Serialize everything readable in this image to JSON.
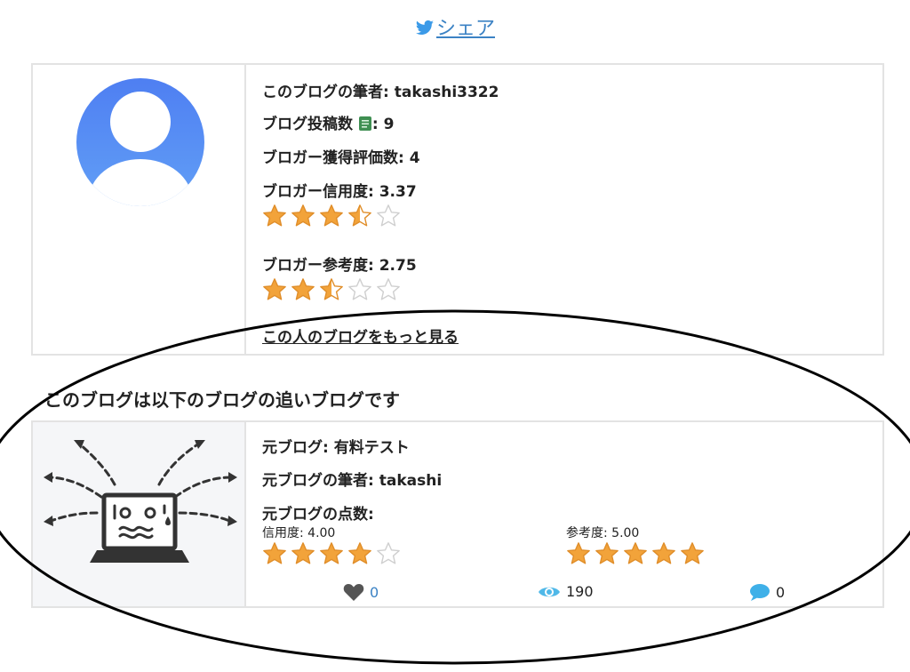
{
  "share": {
    "label": "シェア"
  },
  "author": {
    "name_label": "このブログの筆者: ",
    "name": "takashi3322",
    "posts_label": "ブログ投稿数",
    "posts_value": ": 9",
    "ratings_label": "ブロガー獲得評価数: ",
    "ratings_value": "4",
    "credibility_label": "ブロガー信用度: ",
    "credibility_value": "3.37",
    "credibility_stars": 3.5,
    "reference_label": "ブロガー参考度: ",
    "reference_value": "2.75",
    "reference_stars": 2.5,
    "more_link": "この人のブログをもっと見る"
  },
  "section_heading": "このブログは以下のブログの追いブログです",
  "original": {
    "title_label": "元ブログ: ",
    "title": "有料テスト",
    "author_label": "元ブログの筆者: ",
    "author": "takashi",
    "score_label": "元ブログの点数:",
    "credibility": "信用度: 4.00",
    "credibility_stars": 4,
    "reference": "参考度: 5.00",
    "reference_stars": 5,
    "likes": "0",
    "views": "190",
    "comments": "0"
  },
  "icons": {
    "share": "twitter-bird-icon",
    "avatar": "user-avatar-icon",
    "posts": "book-icon",
    "likes": "heart-icon",
    "views": "eye-icon",
    "comments": "speech-bubble-icon",
    "original_image": "laptop-panic-illustration"
  },
  "colors": {
    "link": "#3b82c4",
    "avatar": "#5b86f0",
    "star": "#f2a33a",
    "border": "#e3e3e3"
  }
}
